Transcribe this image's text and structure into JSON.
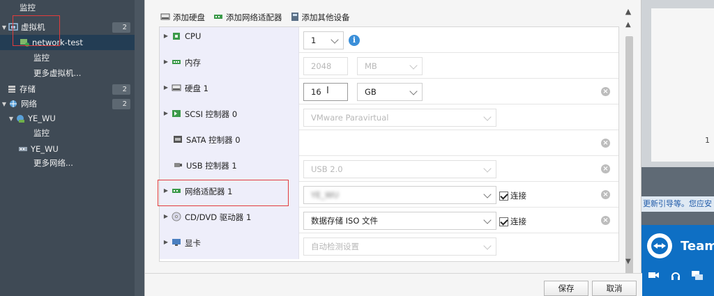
{
  "navigator": {
    "items": [
      {
        "label": "监控",
        "indent": 2,
        "icon": "",
        "badge": ""
      },
      {
        "label": "虚拟机",
        "indent": 0,
        "icon": "vm-icon",
        "badge": "2",
        "caret": "▼"
      },
      {
        "label": "network-test",
        "indent": 1,
        "icon": "vm-running-icon",
        "badge": "",
        "selected": true
      },
      {
        "label": "监控",
        "indent": 2,
        "icon": "",
        "badge": ""
      },
      {
        "label": "更多虚拟机...",
        "indent": 2,
        "icon": "",
        "badge": ""
      },
      {
        "label": "存储",
        "indent": 0,
        "icon": "storage-icon",
        "badge": "2"
      },
      {
        "label": "网络",
        "indent": 0,
        "icon": "network-icon",
        "badge": "2",
        "caret": "▼"
      },
      {
        "label": "YE_WU",
        "indent": 1,
        "icon": "port-group-icon",
        "badge": "",
        "caret": "▼"
      },
      {
        "label": "监控",
        "indent": 2,
        "icon": "",
        "badge": ""
      },
      {
        "label": "YE_WU",
        "indent": 1,
        "icon": "switch-icon",
        "badge": ""
      },
      {
        "label": "更多网络...",
        "indent": 2,
        "icon": "",
        "badge": ""
      }
    ]
  },
  "background_right": {
    "number": "1",
    "notice_text": "更新引导等。您应安",
    "brand": "Team"
  },
  "dialog": {
    "toolbar": {
      "add_disk": "添加硬盘",
      "add_nic": "添加网络适配器",
      "add_other": "添加其他设备"
    },
    "rows": [
      {
        "key": "cpu",
        "label": "CPU",
        "value": "1"
      },
      {
        "key": "memory",
        "label": "内存",
        "value": "2048",
        "unit": "MB"
      },
      {
        "key": "disk",
        "label": "硬盘 1",
        "value": "16",
        "unit": "GB"
      },
      {
        "key": "scsi",
        "label": "SCSI 控制器 0",
        "value": "VMware Paravirtual"
      },
      {
        "key": "sata",
        "label": "SATA 控制器 0",
        "value": ""
      },
      {
        "key": "usb",
        "label": "USB 控制器 1",
        "value": "USB 2.0"
      },
      {
        "key": "nic",
        "label": "网络适配器 1",
        "value": "YE_WU",
        "connect": "连接"
      },
      {
        "key": "cdrom",
        "label": "CD/DVD 驱动器 1",
        "value": "数据存储 ISO 文件",
        "connect": "连接"
      },
      {
        "key": "display",
        "label": "显卡",
        "value": "自动检测设置"
      }
    ],
    "buttons": {
      "save": "保存",
      "cancel": "取消"
    }
  },
  "colors": {
    "highlight": "#e23c3c",
    "selected_nav": "#233d54",
    "info": "#3b8fd9"
  }
}
